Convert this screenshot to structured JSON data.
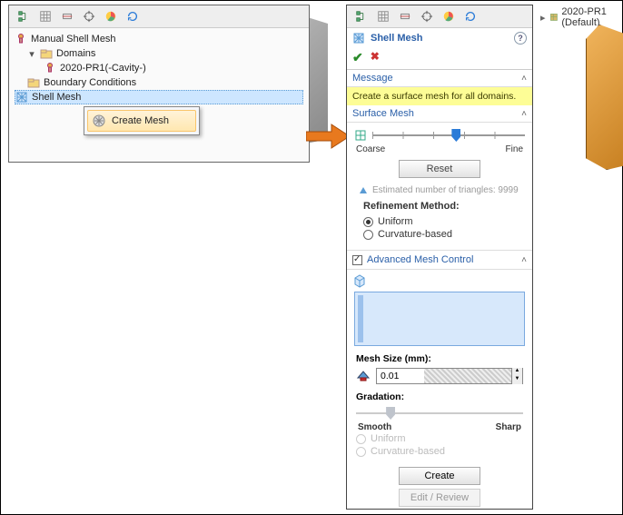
{
  "left": {
    "tree_title": "Manual Shell Mesh",
    "domains_label": "Domains",
    "domain_item": "2020-PR1(-Cavity-)",
    "bc_label": "Boundary Conditions",
    "shell_mesh_label": "Shell Mesh",
    "ctx_create_mesh": "Create Mesh"
  },
  "shellmesh": {
    "title": "Shell Mesh",
    "msg_header": "Message",
    "msg_body": "Create a surface mesh for all domains.",
    "surface_header": "Surface Mesh",
    "coarse": "Coarse",
    "fine": "Fine",
    "reset": "Reset",
    "est_label": "Estimated number of triangles: 9999",
    "refine_header": "Refinement Method:",
    "uniform": "Uniform",
    "curvature": "Curvature-based",
    "adv_header": "Advanced Mesh Control",
    "meshsize_header": "Mesh Size (mm):",
    "meshsize_value": "0.01",
    "gradation_header": "Gradation:",
    "smooth": "Smooth",
    "sharp": "Sharp",
    "create_btn": "Create",
    "edit_btn": "Edit / Review"
  },
  "far": {
    "node": "2020-PR1  (Default)"
  }
}
